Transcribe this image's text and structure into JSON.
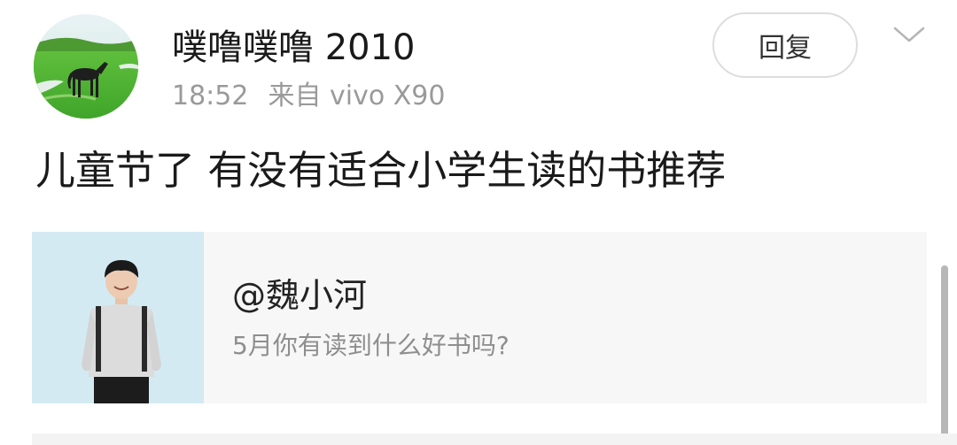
{
  "post": {
    "author": {
      "name": "噗噜噗噜 2010",
      "avatar_icon": "horse-grassland-avatar"
    },
    "time": "18:52",
    "source": "来自 vivo X90",
    "reply_label": "回复",
    "more_icon": "chevron-down-icon",
    "text": "儿童节了 有没有适合小学生读的书推荐"
  },
  "share_card": {
    "thumbnail_icon": "person-with-backpack-photo",
    "handle": "@魏小河",
    "subtitle": "5月你有读到什么好书吗?"
  },
  "colors": {
    "secondary_text": "#9a9a9a",
    "card_background": "#f7f7f7",
    "reply_border": "#dddddd"
  }
}
